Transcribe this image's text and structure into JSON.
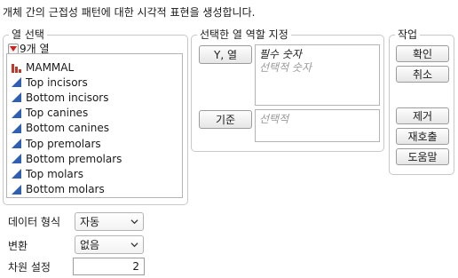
{
  "title": "개체 간의 근접성 패턴에 대한 시각적 표현을 생성합니다.",
  "column_select": {
    "legend": "열 선택",
    "count_label": "9개 열",
    "columns": [
      {
        "name": "MAMMAL",
        "icon": "nominal-bar-icon"
      },
      {
        "name": "Top incisors",
        "icon": "continuous-triangle-icon"
      },
      {
        "name": "Bottom incisors",
        "icon": "continuous-triangle-icon"
      },
      {
        "name": "Top canines",
        "icon": "continuous-triangle-icon"
      },
      {
        "name": "Bottom canines",
        "icon": "continuous-triangle-icon"
      },
      {
        "name": "Top premolars",
        "icon": "continuous-triangle-icon"
      },
      {
        "name": "Bottom premolars",
        "icon": "continuous-triangle-icon"
      },
      {
        "name": "Top molars",
        "icon": "continuous-triangle-icon"
      },
      {
        "name": "Bottom molars",
        "icon": "continuous-triangle-icon"
      }
    ]
  },
  "role_assign": {
    "legend": "선택한 열 역할 지정",
    "y_button": "Y, 열",
    "y_required": "필수 숫자",
    "y_optional": "선택적 숫자",
    "by_button": "기준",
    "by_optional": "선택적"
  },
  "actions": {
    "legend": "작업",
    "ok": "확인",
    "cancel": "취소",
    "remove": "제거",
    "recall": "재호출",
    "help": "도움말"
  },
  "options": {
    "data_format_label": "데이터 형식",
    "data_format_value": "자동",
    "transform_label": "변환",
    "transform_value": "없음",
    "dimension_label": "차원 설정",
    "dimension_value": "2"
  },
  "colors": {
    "nominal_icon": "#c0392b",
    "continuous_icon": "#2f5fb3",
    "red_triangle": "#d21f1f"
  }
}
